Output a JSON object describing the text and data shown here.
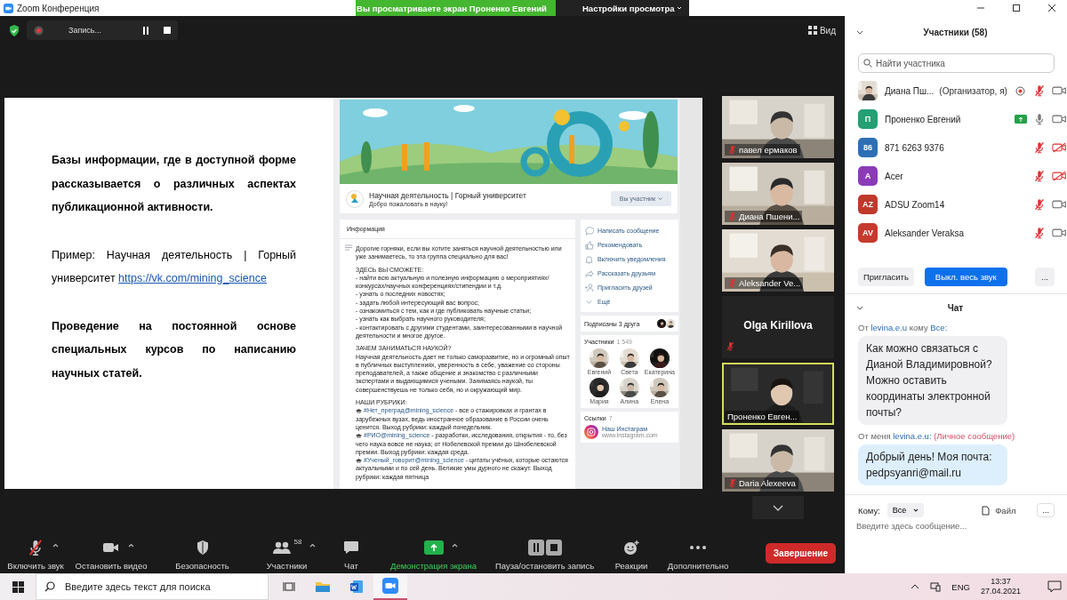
{
  "window": {
    "title": "Zoom Конференция"
  },
  "share_banner": {
    "text": "Вы просматриваете экран Проненко Евгений",
    "options": "Настройки просмотра"
  },
  "meeting_bar": {
    "recording": "Запись...",
    "view": "Вид"
  },
  "slide": {
    "paragraphs": [
      {
        "text": "Базы информации, где в доступной форме рассказывается о различных аспектах публикационной активности.",
        "bold": true
      },
      {
        "text": "Пример: Научная деятельность | Горный университет",
        "link": "https://vk.com/mining_science",
        "bold": false
      },
      {
        "text": "Проведение на постоянной основе специальных курсов по написанию научных статей.",
        "bold": true
      }
    ]
  },
  "vk": {
    "group": {
      "title": "Научная деятельность | Горный университет",
      "status": "Добро пожаловать в науку!",
      "button": "Вы участник"
    },
    "info": {
      "title": "Информация",
      "blocks": [
        [
          {
            "kind": "line",
            "text": "Дорогие горняки, если вы хотите заняться научной деятельностью или уже занимаетесь, то эта группа специально для вас!"
          }
        ],
        [
          {
            "kind": "line",
            "text": "ЗДЕСЬ ВЫ СМОЖЕТЕ:"
          },
          {
            "kind": "line",
            "text": "- найти всю актуальную и полезную информацию о мероприятиях/ конкурсах/научных конференциях/стипендии и т.д."
          },
          {
            "kind": "line",
            "text": "- узнать о последних новостях;"
          },
          {
            "kind": "line",
            "text": "- задать любой интересующий вас вопрос;"
          },
          {
            "kind": "line",
            "text": "- ознакомиться с тем, как и где публиковать научные статьи;"
          },
          {
            "kind": "line",
            "text": "- узнать как выбрать научного руководителя;"
          },
          {
            "kind": "line",
            "text": "- контактировать с другими студентами, заинтересованными в научной деятельности и многое другое."
          }
        ],
        [
          {
            "kind": "line",
            "text": "ЗАЧЕМ ЗАНИМАТЬСЯ НАУКОЙ?"
          },
          {
            "kind": "line",
            "text": "Научная деятельность дает не только саморазвитие, но и огромный опыт в публичных выступлениях, уверенность в себе, уважение со стороны преподавателей, а также общение и знакомство с различными экспертами и выдающимися учеными. Занимаясь наукой, ты совершенствуешь не только себя, но и окружающий мир."
          }
        ],
        [
          {
            "kind": "line",
            "text": "НАШИ РУБРИКИ:"
          },
          {
            "kind": "rubric",
            "tag": "#Нет_преград@mining_science",
            "text": " - все о стажировках и грантах в зарубежных вузах, ведь иностранное образование в России очень ценится. Выход рубрики: каждый понедельник."
          },
          {
            "kind": "rubric",
            "tag": "#РИО@mining_science",
            "text": " - разработки, исследования, открытия - то, без чего наука вовсе не наука; от Нобелевской премии до Шнобелевской премии. Выход рубрики: каждая среда."
          },
          {
            "kind": "rubric",
            "tag": "#Ученый_говорит@mining_science",
            "text": " - цитаты учёных, которые остаются актуальными и по сей день. Великие умы дурного не скажут. Выход рубрики: каждая пятница"
          }
        ]
      ]
    },
    "actions": [
      {
        "label": "Написать сообщение",
        "kind": "message"
      },
      {
        "label": "Рекомендовать",
        "kind": "like"
      },
      {
        "label": "Включить уведомления",
        "kind": "bell"
      },
      {
        "label": "Рассказать друзьям",
        "kind": "share"
      },
      {
        "label": "Пригласить друзей",
        "kind": "invite"
      },
      {
        "label": "Ещё",
        "kind": "more"
      }
    ],
    "friends": {
      "label": "Подписаны 3 друга"
    },
    "members": {
      "title": "Участники",
      "count": "1 549",
      "people": [
        "Евгений",
        "Света",
        "Екатерина",
        "Мария",
        "Алина",
        "Елена"
      ]
    },
    "links": {
      "title": "Ссылки",
      "count": "7",
      "items": [
        {
          "title": "Наш Инстаграм",
          "url": "www.instagram.com"
        }
      ]
    }
  },
  "video_tiles": [
    {
      "name": "павел ермаков",
      "kind": "video",
      "muted": true,
      "selected": false
    },
    {
      "name": "Диана Пшени...",
      "kind": "video",
      "muted": true,
      "selected": false
    },
    {
      "name": "Aleksander Ve...",
      "kind": "video",
      "muted": true,
      "selected": false
    },
    {
      "name": "Olga Kirillova",
      "kind": "name",
      "muted": true,
      "selected": false
    },
    {
      "name": "Проненко Евген...",
      "kind": "video",
      "muted": false,
      "selected": true
    },
    {
      "name": "Daria Alexeeva",
      "kind": "video",
      "muted": true,
      "selected": false
    }
  ],
  "toolbar": {
    "audio_muted": true,
    "items": [
      {
        "label": "Включить звук",
        "kind": "mic",
        "caret": true
      },
      {
        "label": "Остановить видео",
        "kind": "video",
        "caret": true
      },
      {
        "label": "Безопасность",
        "kind": "security",
        "caret": false
      },
      {
        "label": "Участники",
        "kind": "participants",
        "count": "58",
        "caret": true
      },
      {
        "label": "Чат",
        "kind": "chat",
        "caret": false
      },
      {
        "label": "Демонстрация экрана",
        "kind": "share",
        "caret": true
      },
      {
        "label": "Пауза/остановить запись",
        "kind": "record",
        "caret": false
      },
      {
        "label": "Реакции",
        "kind": "reactions",
        "caret": false
      },
      {
        "label": "Дополнительно",
        "kind": "more",
        "caret": false
      }
    ],
    "end": "Завершение"
  },
  "participants": {
    "title": "Участники (58)",
    "search": {
      "placeholder": "Найти участника"
    },
    "items": [
      {
        "name": "Диана Пш...",
        "role": "(Организатор, я)",
        "recording": true,
        "sharing": false,
        "muted": true,
        "video": true
      },
      {
        "name": "Проненко Евгений",
        "kind": "initials",
        "initials": "П",
        "color": "#23a074",
        "recording": false,
        "sharing": true,
        "muted": false,
        "video": true
      },
      {
        "name": "871 6263 9376",
        "kind": "initials",
        "initials": "86",
        "color": "#2d6fb4",
        "recording": false,
        "sharing": false,
        "muted": true,
        "video": false
      },
      {
        "name": "Acer",
        "kind": "initials",
        "initials": "A",
        "color": "#8b3bb7",
        "recording": false,
        "sharing": false,
        "muted": true,
        "video": false
      },
      {
        "name": "ADSU Zoom14",
        "kind": "initials",
        "initials": "AZ",
        "color": "#c0392b",
        "recording": false,
        "sharing": false,
        "muted": true,
        "video": true
      },
      {
        "name": "Aleksander Veraksa",
        "kind": "initials",
        "initials": "AV",
        "color": "#c73a2e",
        "recording": false,
        "sharing": false,
        "muted": true,
        "video": true
      }
    ],
    "buttons": [
      {
        "label": "Пригласить",
        "kind": "plain"
      },
      {
        "label": "Выкл. весь звук",
        "kind": "primary"
      },
      {
        "label": "...",
        "kind": "plain"
      }
    ]
  },
  "chat": {
    "title": "Чат",
    "messages": [
      {
        "kind": "received",
        "header": [
          {
            "kind": "plain",
            "text": "От"
          },
          {
            "kind": "name",
            "text": "levina.e.u"
          },
          {
            "kind": "plain",
            "text": "кому"
          },
          {
            "kind": "name",
            "text": "Все:"
          }
        ],
        "text": "Как можно связаться с Дианой Владимировной? Можно оставить координаты электронной почты?"
      },
      {
        "kind": "private",
        "header": [
          {
            "kind": "plain",
            "text": "От меня"
          },
          {
            "kind": "name",
            "text": "levina.e.u:"
          },
          {
            "kind": "private",
            "text": "(Личное сообщение)"
          }
        ],
        "text": "Добрый день! Моя почта: pedpsyanri@mail.ru"
      }
    ],
    "to_label": "Кому:",
    "to_value": "Все",
    "file": "Файл",
    "more": "...",
    "placeholder": "Введите здесь сообщение..."
  },
  "taskbar": {
    "placeholder": "Введите здесь текст для поиска",
    "apps": [
      {
        "kind": "taskview",
        "selected": false
      },
      {
        "kind": "explorer",
        "selected": false
      },
      {
        "kind": "word",
        "selected": false
      },
      {
        "kind": "zoom",
        "selected": true
      }
    ],
    "language": "ENG",
    "time": "13:37",
    "date": "27.04.2021"
  }
}
